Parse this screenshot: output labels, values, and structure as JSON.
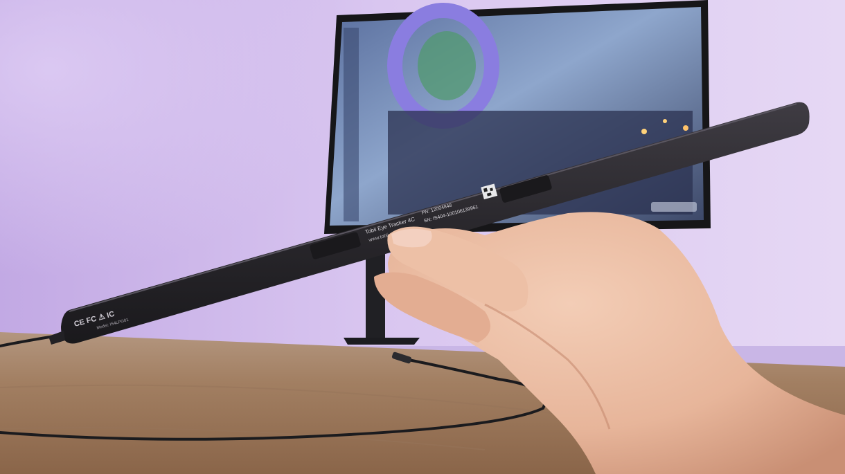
{
  "scene": {
    "colors": {
      "wall_left": "#c7b2e6",
      "wall_right": "#e3d4f3",
      "desk_top": "#a27f62",
      "desk_front": "#7d5b43",
      "tracker_body": "#262428",
      "tracker_highlight": "#3d3a40",
      "cable": "#1b1b1e",
      "skin": "#e9b99e",
      "skin_shadow": "#cf9b82",
      "monitor_bezel": "#161618",
      "screen_sky": "#6f88b6",
      "stadium_purple": "#8276dc"
    }
  },
  "device": {
    "label_line1": "Tobii Eye Tracker 4C",
    "label_line2": "www.tobii.com",
    "pn": "PN: 12004848",
    "sn": "SN: IS404-100106139961",
    "marks": "CE  FC  ⚠ IC",
    "model": "Model: IS4LPG01"
  }
}
